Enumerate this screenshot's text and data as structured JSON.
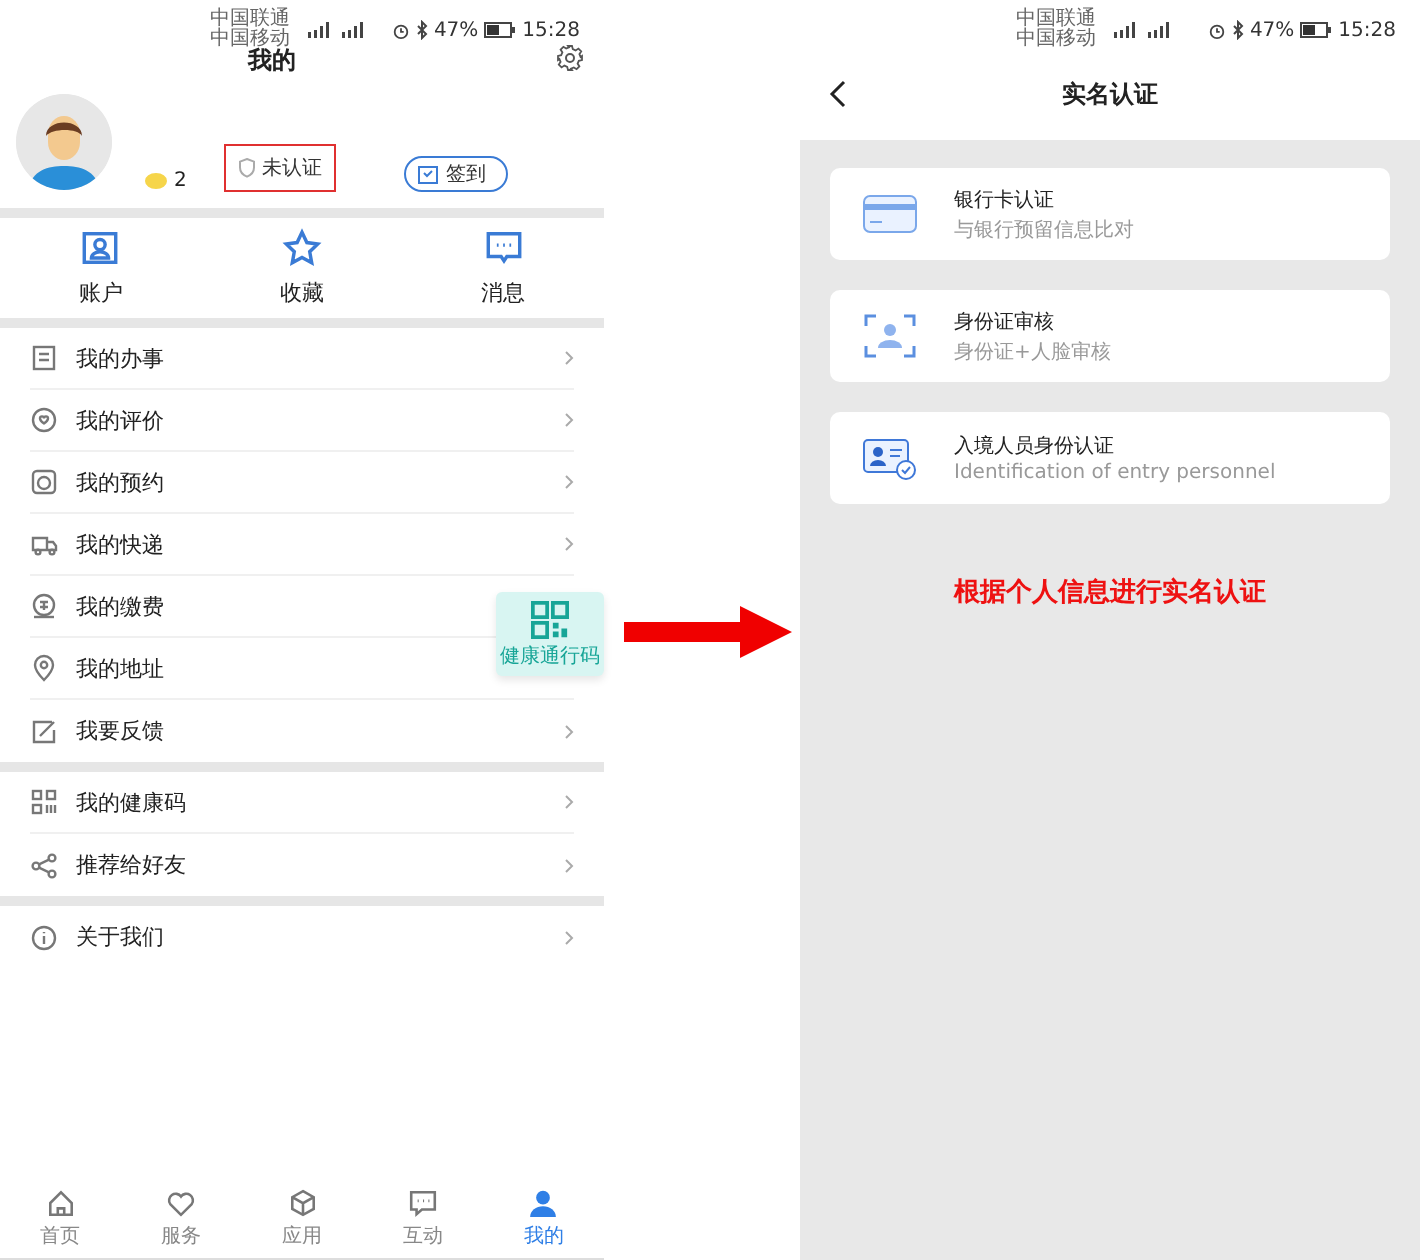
{
  "left_screen": {
    "status_bar": {
      "carriers": [
        "中国联通",
        "中国移动"
      ],
      "battery": "47%",
      "time": "15:28"
    },
    "title": "我的",
    "profile": {
      "points": "2",
      "verify_badge": "未认证",
      "checkin_button": "签到"
    },
    "shortcuts": [
      {
        "label": "账户"
      },
      {
        "label": "收藏"
      },
      {
        "label": "消息"
      }
    ],
    "menu_groups": [
      [
        {
          "label": "我的办事"
        },
        {
          "label": "我的评价"
        },
        {
          "label": "我的预约"
        },
        {
          "label": "我的快递"
        },
        {
          "label": "我的缴费"
        },
        {
          "label": "我的地址"
        },
        {
          "label": "我要反馈"
        }
      ],
      [
        {
          "label": "我的健康码"
        },
        {
          "label": "推荐给好友"
        }
      ],
      [
        {
          "label": "关于我们"
        }
      ]
    ],
    "floating_button": {
      "label": "健康通行码"
    },
    "tab_bar": [
      {
        "label": "首页",
        "selected": false
      },
      {
        "label": "服务",
        "selected": false
      },
      {
        "label": "应用",
        "selected": false
      },
      {
        "label": "互动",
        "selected": false
      },
      {
        "label": "我的",
        "selected": true
      }
    ]
  },
  "right_screen": {
    "status_bar": {
      "carriers": [
        "中国联通",
        "中国移动"
      ],
      "battery": "47%",
      "time": "15:28"
    },
    "title": "实名认证",
    "options": [
      {
        "title": "银行卡认证",
        "subtitle": "与银行预留信息比对"
      },
      {
        "title": "身份证审核",
        "subtitle": "身份证+人脸审核"
      },
      {
        "title": "入境人员身份认证",
        "subtitle": "Identification of entry personnel"
      }
    ],
    "note": "根据个人信息进行实名认证"
  }
}
